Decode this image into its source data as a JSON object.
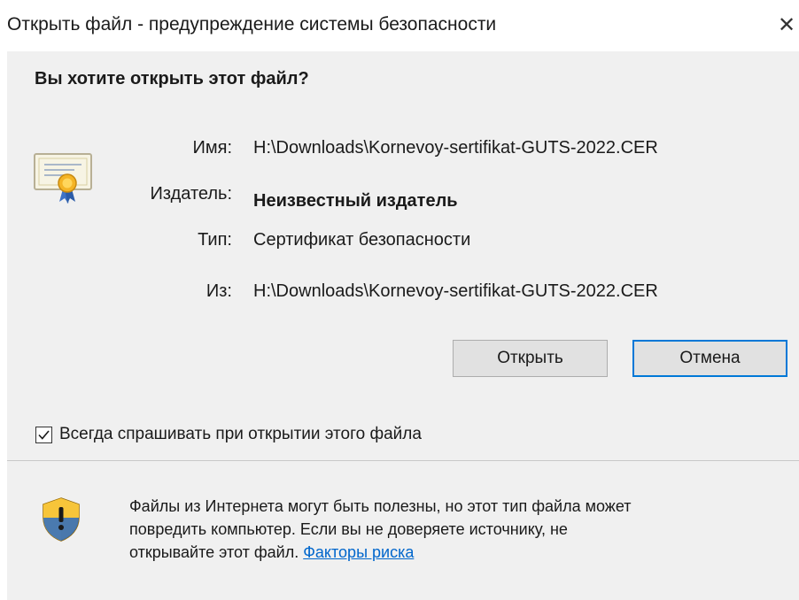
{
  "window": {
    "title": "Открыть файл - предупреждение системы безопасности",
    "close_glyph": "✕"
  },
  "dialog": {
    "question": "Вы хотите открыть этот файл?",
    "fields": {
      "name_label": "Имя:",
      "name_value": "H:\\Downloads\\Kornevoy-sertifikat-GUTS-2022.CER",
      "publisher_label": "Издатель:",
      "publisher_value": "Неизвестный издатель",
      "type_label": "Тип:",
      "type_value": "Сертификат безопасности",
      "from_label": "Из:",
      "from_value": "H:\\Downloads\\Kornevoy-sertifikat-GUTS-2022.CER"
    },
    "buttons": {
      "open_label": "Открыть",
      "cancel_label": "Отмена"
    },
    "checkbox": {
      "label": "Всегда спрашивать при открытии этого файла",
      "checked": true
    }
  },
  "footer": {
    "warning_line1": "Файлы из Интернета могут быть полезны, но этот тип файла может",
    "warning_line2": "повредить компьютер. Если вы не доверяете источнику, не",
    "warning_line3_prefix": "открывайте этот файл. ",
    "risk_link_label": "Факторы риска"
  },
  "icons": {
    "certificate": "certificate-icon",
    "shield": "security-shield-icon",
    "checkmark": "checkmark-icon"
  },
  "colors": {
    "dialog_bg": "#f0f0f0",
    "default_button_border": "#0078d7",
    "link": "#0066cc",
    "shield_gold": "#f2b823",
    "shield_blue": "#2b6cc4"
  }
}
